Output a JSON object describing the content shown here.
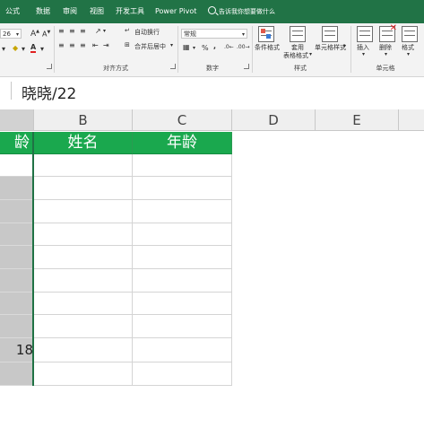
{
  "ribbon_tabs": [
    "公式",
    "数据",
    "审阅",
    "视图",
    "开发工具",
    "Power Pivot"
  ],
  "tell_me": "告诉我你想要做什么",
  "font": {
    "size": "26",
    "grow": "A",
    "shrink": "A"
  },
  "alignment": {
    "wrap_text": "自动换行",
    "merge_center": "合并后居中",
    "group_label": "对齐方式"
  },
  "number": {
    "format": "常规",
    "percent": "%",
    "comma": ",",
    "group_label": "数字"
  },
  "styles": {
    "conditional_formatting": "条件格式",
    "format_as_table_line1": "套用",
    "format_as_table_line2": "表格格式",
    "cell_styles": "单元格样式",
    "group_label": "样式"
  },
  "cells": {
    "insert": "插入",
    "delete": "删除",
    "format": "格式",
    "group_label": "单元格"
  },
  "formula_bar": {
    "content": "晓晓/22"
  },
  "columns": [
    "B",
    "C",
    "D",
    "E"
  ],
  "header_row": {
    "a": "龄",
    "b": "姓名",
    "c": "年龄"
  },
  "col_a_value": "18",
  "colors": {
    "accent_green": "#217346",
    "header_green": "#1aa84e",
    "selected_gray": "#c8c8c8"
  }
}
